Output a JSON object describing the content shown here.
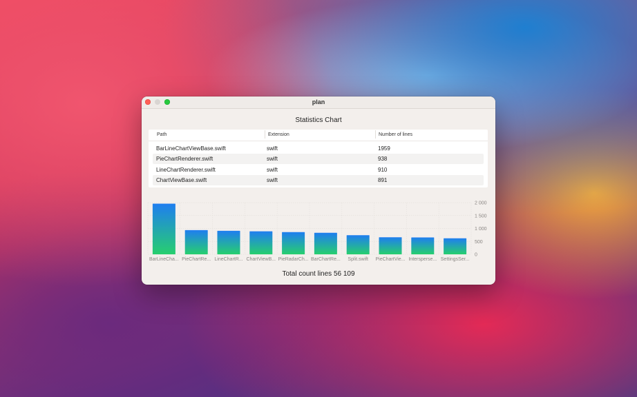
{
  "window": {
    "title": "plan",
    "heading": "Statistics Chart",
    "total_label": "Total count lines 56 109"
  },
  "table": {
    "columns": [
      "Path",
      "Extension",
      "Number of lines"
    ],
    "rows": [
      {
        "path": "BarLineChartViewBase.swift",
        "extension": "swift",
        "lines": "1959"
      },
      {
        "path": "PieChartRenderer.swift",
        "extension": "swift",
        "lines": "938"
      },
      {
        "path": "LineChartRenderer.swift",
        "extension": "swift",
        "lines": "910"
      },
      {
        "path": "ChartViewBase.swift",
        "extension": "swift",
        "lines": "891"
      }
    ]
  },
  "chart_data": {
    "type": "bar",
    "categories": [
      "BarLineCha...",
      "PieChartRe...",
      "LineChartR...",
      "ChartViewB...",
      "PieRadarCh...",
      "BarChartRe...",
      "Split.swift",
      "PieChartVie...",
      "Intersperse...",
      "SettingsSer..."
    ],
    "values": [
      1959,
      938,
      910,
      891,
      860,
      835,
      740,
      660,
      655,
      620
    ],
    "ylim": [
      0,
      2000
    ],
    "yticks": [
      0,
      500,
      1000,
      1500,
      2000
    ],
    "ytick_labels": [
      "0",
      "500",
      "1 000",
      "1 500",
      "2 000"
    ],
    "grid": true,
    "y_axis_position": "right",
    "bar_gradient": [
      "#1f7ef0",
      "#27cf6e"
    ]
  }
}
